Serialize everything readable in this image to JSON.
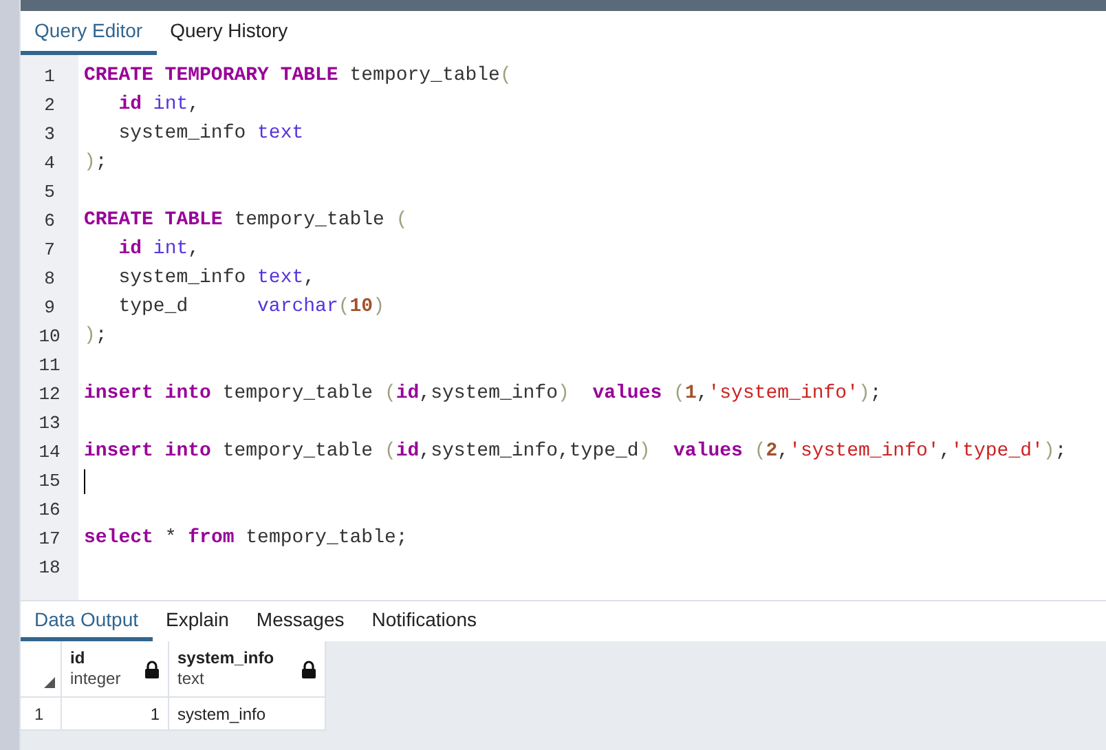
{
  "editor_tabs": [
    {
      "label": "Query Editor",
      "selected": true
    },
    {
      "label": "Query History",
      "selected": false
    }
  ],
  "code_lines": [
    {
      "number": "1",
      "cursor": false,
      "tokens": [
        {
          "kind": "keyword",
          "text": "CREATE TEMPORARY TABLE"
        },
        {
          "kind": "plain",
          "text": " tempory_table"
        },
        {
          "kind": "paren",
          "text": "("
        }
      ]
    },
    {
      "number": "2",
      "cursor": false,
      "tokens": [
        {
          "kind": "keyword",
          "text": "   id"
        },
        {
          "kind": "type",
          "text": " int"
        },
        {
          "kind": "plain",
          "text": ","
        }
      ]
    },
    {
      "number": "3",
      "cursor": false,
      "tokens": [
        {
          "kind": "plain",
          "text": "   system_info "
        },
        {
          "kind": "type",
          "text": "text"
        }
      ]
    },
    {
      "number": "4",
      "cursor": false,
      "tokens": [
        {
          "kind": "paren",
          "text": ")"
        },
        {
          "kind": "plain",
          "text": ";"
        }
      ]
    },
    {
      "number": "5",
      "cursor": false
    },
    {
      "number": "6",
      "cursor": false,
      "tokens": [
        {
          "kind": "keyword",
          "text": "CREATE TABLE"
        },
        {
          "kind": "plain",
          "text": " tempory_table "
        },
        {
          "kind": "paren",
          "text": "("
        }
      ]
    },
    {
      "number": "7",
      "cursor": false,
      "tokens": [
        {
          "kind": "keyword",
          "text": "   id"
        },
        {
          "kind": "type",
          "text": " int"
        },
        {
          "kind": "plain",
          "text": ","
        }
      ]
    },
    {
      "number": "8",
      "cursor": false,
      "tokens": [
        {
          "kind": "plain",
          "text": "   system_info "
        },
        {
          "kind": "type",
          "text": "text"
        },
        {
          "kind": "plain",
          "text": ","
        }
      ]
    },
    {
      "number": "9",
      "cursor": false,
      "tokens": [
        {
          "kind": "plain",
          "text": "   type_d      "
        },
        {
          "kind": "type",
          "text": "varchar"
        },
        {
          "kind": "paren",
          "text": "("
        },
        {
          "kind": "number",
          "text": "10"
        },
        {
          "kind": "paren",
          "text": ")"
        }
      ]
    },
    {
      "number": "10",
      "cursor": false,
      "tokens": [
        {
          "kind": "paren",
          "text": ")"
        },
        {
          "kind": "plain",
          "text": ";"
        }
      ]
    },
    {
      "number": "11",
      "cursor": false
    },
    {
      "number": "12",
      "cursor": false,
      "tokens": [
        {
          "kind": "keyword",
          "text": "insert into"
        },
        {
          "kind": "plain",
          "text": " tempory_table "
        },
        {
          "kind": "paren",
          "text": "("
        },
        {
          "kind": "keyword",
          "text": "id"
        },
        {
          "kind": "plain",
          "text": ",system_info"
        },
        {
          "kind": "paren",
          "text": ")"
        },
        {
          "kind": "keyword",
          "text": "  values"
        },
        {
          "kind": "paren",
          "text": " ("
        },
        {
          "kind": "number",
          "text": "1"
        },
        {
          "kind": "plain",
          "text": ","
        },
        {
          "kind": "string",
          "text": "'system_info'"
        },
        {
          "kind": "paren",
          "text": ")"
        },
        {
          "kind": "plain",
          "text": ";"
        }
      ]
    },
    {
      "number": "13",
      "cursor": false
    },
    {
      "number": "14",
      "cursor": false,
      "tokens": [
        {
          "kind": "keyword",
          "text": "insert into"
        },
        {
          "kind": "plain",
          "text": " tempory_table "
        },
        {
          "kind": "paren",
          "text": "("
        },
        {
          "kind": "keyword",
          "text": "id"
        },
        {
          "kind": "plain",
          "text": ",system_info,type_d"
        },
        {
          "kind": "paren",
          "text": ")"
        },
        {
          "kind": "keyword",
          "text": "  values"
        },
        {
          "kind": "paren",
          "text": " ("
        },
        {
          "kind": "number",
          "text": "2"
        },
        {
          "kind": "plain",
          "text": ","
        },
        {
          "kind": "string",
          "text": "'system_info'"
        },
        {
          "kind": "plain",
          "text": ","
        },
        {
          "kind": "string",
          "text": "'type_d'"
        },
        {
          "kind": "paren",
          "text": ")"
        },
        {
          "kind": "plain",
          "text": ";"
        }
      ]
    },
    {
      "number": "15",
      "cursor": true
    },
    {
      "number": "16",
      "cursor": false
    },
    {
      "number": "17",
      "cursor": false,
      "tokens": [
        {
          "kind": "keyword",
          "text": "select"
        },
        {
          "kind": "plain",
          "text": " * "
        },
        {
          "kind": "keyword",
          "text": "from"
        },
        {
          "kind": "plain",
          "text": " tempory_table;"
        }
      ]
    },
    {
      "number": "18",
      "cursor": false
    }
  ],
  "output_tabs": [
    {
      "label": "Data Output",
      "selected": true
    },
    {
      "label": "Explain",
      "selected": false
    },
    {
      "label": "Messages",
      "selected": false
    },
    {
      "label": "Notifications",
      "selected": false
    }
  ],
  "grid": {
    "columns": [
      {
        "name": "id",
        "type": "integer",
        "locked": true
      },
      {
        "name": "system_info",
        "type": "text",
        "locked": true
      }
    ],
    "rows": [
      {
        "number": "1",
        "cells": [
          "1",
          "system_info"
        ]
      }
    ]
  }
}
